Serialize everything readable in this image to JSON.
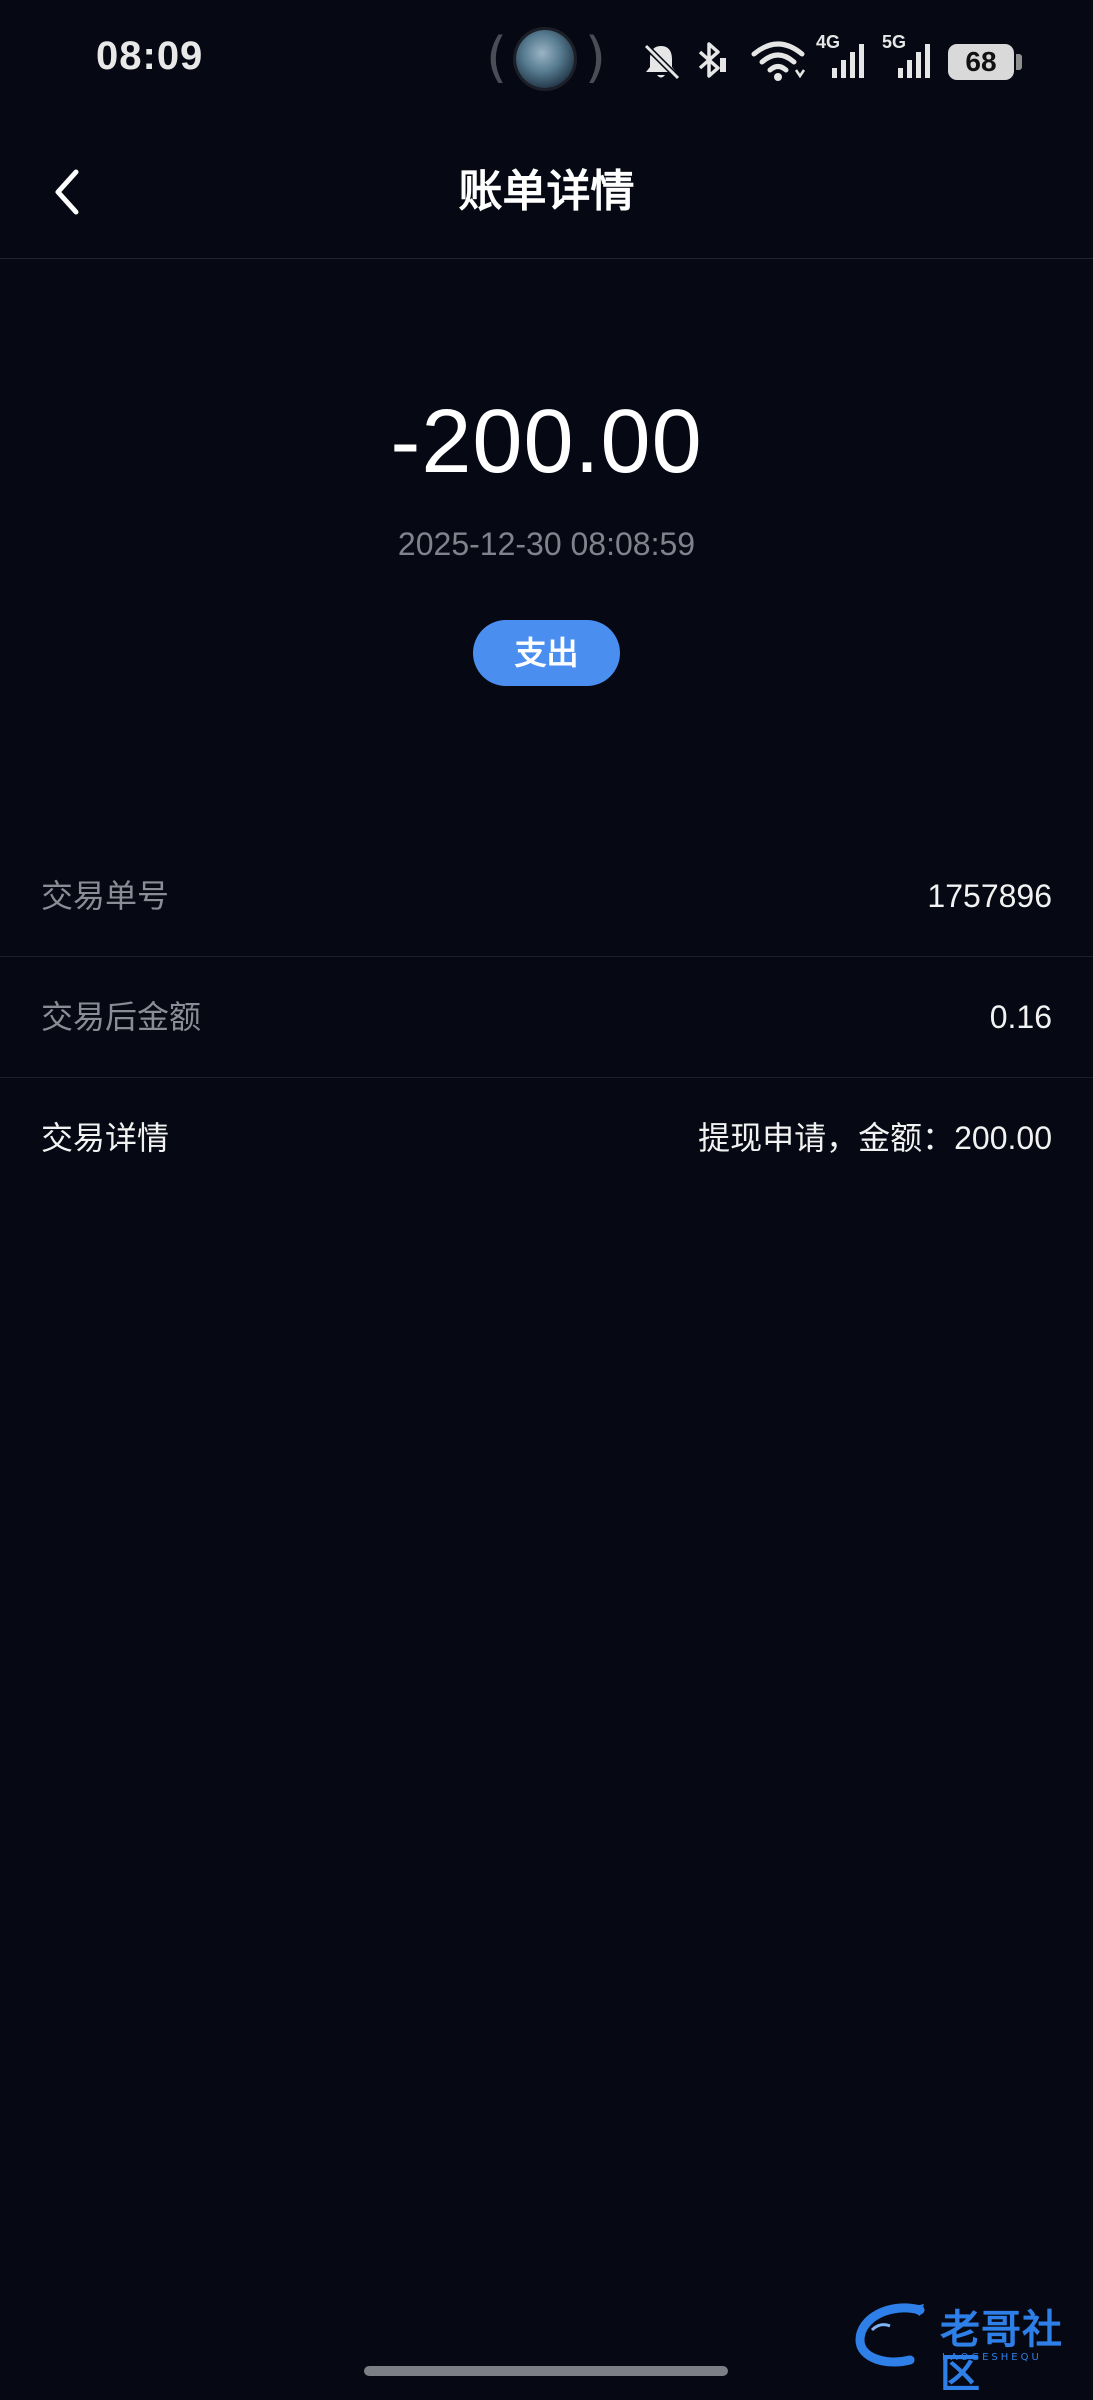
{
  "status_bar": {
    "time": "08:09",
    "network_4g": "4G",
    "network_5g": "5G",
    "battery_level": "68",
    "icons": [
      "mute-bell-icon",
      "bluetooth-icon",
      "wifi-icon",
      "signal-4g-icon",
      "signal-5g-icon",
      "battery-icon"
    ]
  },
  "header": {
    "title": "账单详情",
    "back_icon": "chevron-left-icon"
  },
  "transaction": {
    "amount": "-200.00",
    "datetime": "2025-12-30 08:08:59",
    "type_label": "支出",
    "badge_color": "#4a8ff0"
  },
  "details": [
    {
      "label": "交易单号",
      "value": "1757896"
    },
    {
      "label": "交易后金额",
      "value": "0.16"
    },
    {
      "label": "交易详情",
      "value": "提现申请，金额：200.00"
    }
  ],
  "watermark": {
    "text": "老哥社区",
    "subtext": "LAOGESHEQU",
    "color": "#2f7fe8"
  },
  "colors": {
    "background": "#060913",
    "accent": "#4a8ff0",
    "muted_text": "#80838c"
  }
}
